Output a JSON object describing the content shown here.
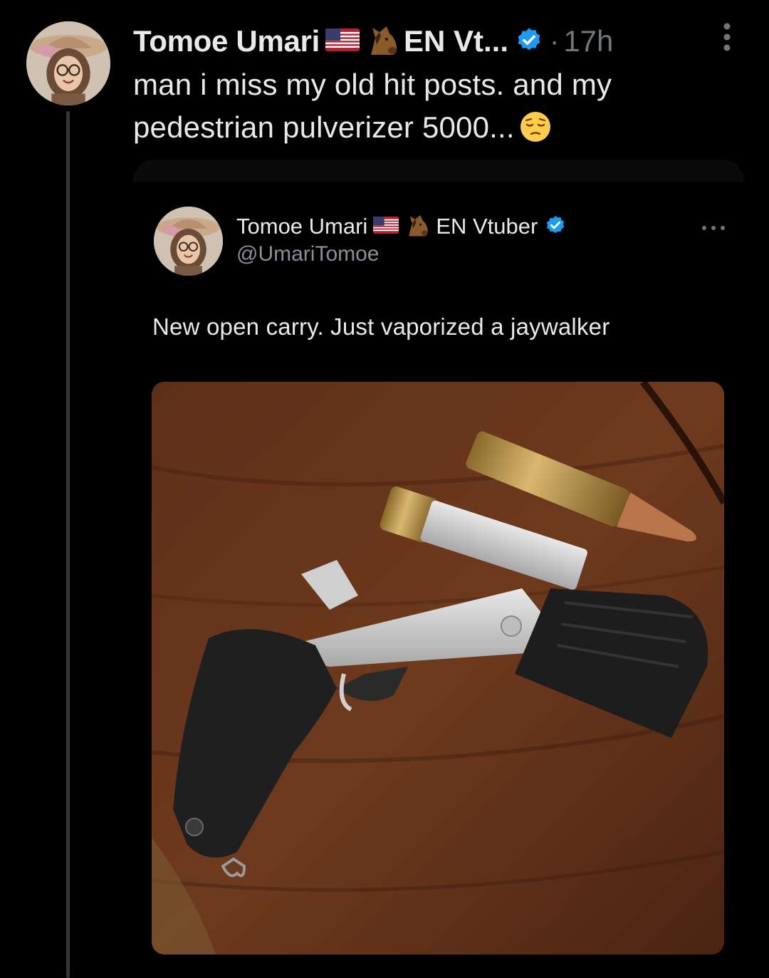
{
  "post": {
    "display_name": "Tomoe Umari",
    "name_suffix": "EN Vt...",
    "separator": "·",
    "timestamp": "17h",
    "text_line1": "man i miss my old hit posts. and my",
    "text_line2": "pedestrian pulverizer 5000...",
    "emojis": [
      "us-flag",
      "horse-face",
      "pensive-face"
    ]
  },
  "quoted_post": {
    "display_name": "Tomoe Umari",
    "name_suffix": "EN Vtuber",
    "handle": "@UmariTomoe",
    "text": "New open carry. Just vaporized a jaywalker",
    "image": {
      "subject": "single-shot-pistol-with-large-rifle-cartridges-on-wood-table"
    }
  },
  "colors": {
    "background": "#000000",
    "text_primary": "#e7e9ea",
    "text_secondary": "#71767b",
    "verified_blue": "#1d9bf0",
    "thread_line": "#333639"
  }
}
